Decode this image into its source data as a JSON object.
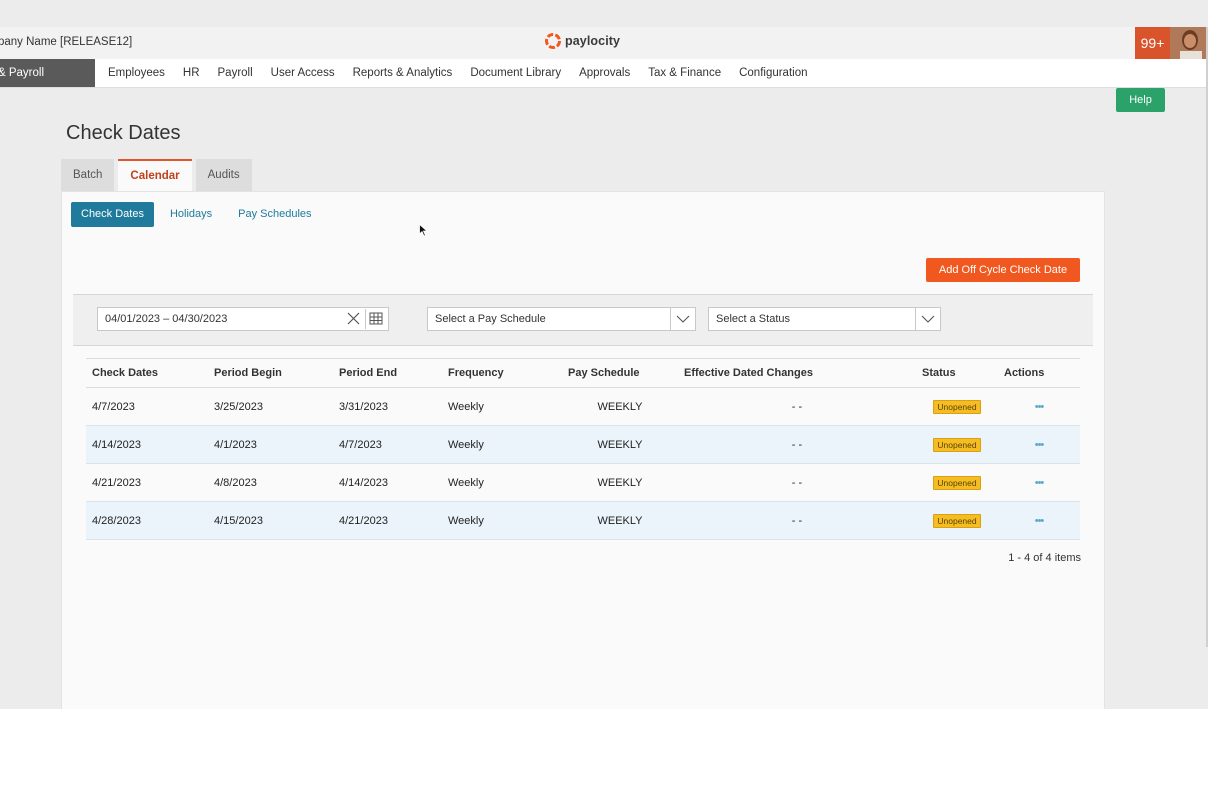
{
  "header": {
    "company": "pany Name [RELEASE12]",
    "logo_text": "paylocity",
    "notifications": "99+"
  },
  "nav": {
    "product": "& Payroll",
    "items": [
      "Employees",
      "HR",
      "Payroll",
      "User Access",
      "Reports & Analytics",
      "Document Library",
      "Approvals",
      "Tax & Finance",
      "Configuration"
    ]
  },
  "help_label": "Help",
  "page_title": "Check Dates",
  "tabs": [
    "Batch",
    "Calendar",
    "Audits"
  ],
  "subtabs": [
    "Check Dates",
    "Holidays",
    "Pay Schedules"
  ],
  "add_button": "Add Off Cycle Check Date",
  "filters": {
    "date_range": "04/01/2023 – 04/30/2023",
    "pay_schedule_placeholder": "Select a Pay Schedule",
    "status_placeholder": "Select a Status"
  },
  "table": {
    "headers": [
      "Check Dates",
      "Period Begin",
      "Period End",
      "Frequency",
      "Pay Schedule",
      "Effective Dated Changes",
      "Status",
      "Actions"
    ],
    "rows": [
      [
        "4/7/2023",
        "3/25/2023",
        "3/31/2023",
        "Weekly",
        "WEEKLY",
        "- -",
        "Unopened",
        "•••"
      ],
      [
        "4/14/2023",
        "4/1/2023",
        "4/7/2023",
        "Weekly",
        "WEEKLY",
        "- -",
        "Unopened",
        "•••"
      ],
      [
        "4/21/2023",
        "4/8/2023",
        "4/14/2023",
        "Weekly",
        "WEEKLY",
        "- -",
        "Unopened",
        "•••"
      ],
      [
        "4/28/2023",
        "4/15/2023",
        "4/21/2023",
        "Weekly",
        "WEEKLY",
        "- -",
        "Unopened",
        "•••"
      ]
    ]
  },
  "pager": "1 - 4 of 4 items",
  "colors": {
    "accent_orange": "#f0581f",
    "tab_active": "#c2401a",
    "subtab_blue": "#1f7a9c",
    "help_green": "#2aa26a",
    "badge_yellow": "#f5bd23",
    "row_alt": "#eaf4fa"
  }
}
